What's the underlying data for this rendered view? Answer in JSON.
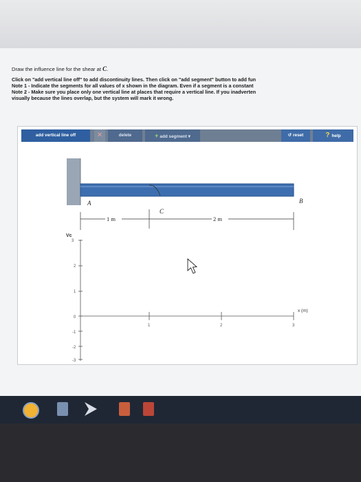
{
  "instructions": {
    "question": "Draw the influence line for the shear at ",
    "question_point": "C",
    "question_end": ".",
    "line1": "Click on \"add vertical line off\" to add discontinuity lines. Then click on \"add segment\" button to add fun",
    "line2": "Note 1 - Indicate the segments for all values of x shown in the diagram. Even if a segment is a constant",
    "line3": "Note 2 - Make sure you place only one vertical line at places that require a vertical line. If you inadverten",
    "line4": "visually because the lines overlap, but the system will mark it wrong."
  },
  "toolbar": {
    "vline_label": "add vertical line off",
    "x_glyph": "✕",
    "delete_label": "delete",
    "segment_label": "add segment",
    "segment_plus": "+",
    "segment_caret": "▾",
    "reset_label": "reset",
    "reset_icon": "↺",
    "help_icon": "?",
    "help_label": "help"
  },
  "beam": {
    "label_a": "A",
    "label_b": "B",
    "label_c": "C",
    "dim_ac": "1 m",
    "dim_cb": "2 m"
  },
  "plot": {
    "ylabel": "Vc",
    "xlabel": "x (m)",
    "y_ticks": [
      "3",
      "2",
      "1",
      "0",
      "-1",
      "-2",
      "-3"
    ],
    "x_ticks": [
      "1",
      "2",
      "3"
    ]
  },
  "colors": {
    "toolbar": "#6f7f93",
    "vline_btn": "#2f5fa0",
    "beam": "#3d6fb0",
    "wall": "#9aa6b4"
  }
}
